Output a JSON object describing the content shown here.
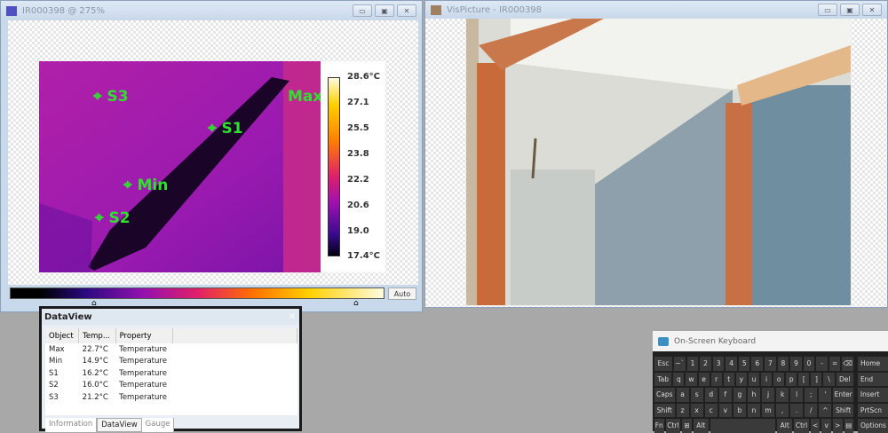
{
  "ir_window": {
    "title": "IR000398 @ 275%",
    "auto_label": "Auto",
    "scale": {
      "max": "28.6°C",
      "ticks": [
        "27.1",
        "25.5",
        "23.8",
        "22.2",
        "20.6",
        "19.0"
      ],
      "min": "17.4°C"
    },
    "markers": [
      "S3",
      "S1",
      "Max",
      "Min",
      "S2"
    ]
  },
  "vis_window": {
    "title": "VisPicture - IR000398"
  },
  "window_controls": {
    "minimize": "▭",
    "restore": "▣",
    "close": "✕"
  },
  "dataview": {
    "title": "DataView",
    "close": "×",
    "columns": [
      "Object",
      "Temp...",
      "Property"
    ],
    "rows": [
      [
        "Max",
        "22.7°C",
        "Temperature"
      ],
      [
        "Min",
        "14.9°C",
        "Temperature"
      ],
      [
        "S1",
        "16.2°C",
        "Temperature"
      ],
      [
        "S2",
        "16.0°C",
        "Temperature"
      ],
      [
        "S3",
        "21.2°C",
        "Temperature"
      ]
    ],
    "tabs": [
      "Information",
      "DataView",
      "Gauge"
    ],
    "active_tab": "DataView"
  },
  "keyboard": {
    "title": "On-Screen Keyboard",
    "rows": [
      [
        "Esc",
        "~`",
        "1",
        "2",
        "3",
        "4",
        "5",
        "6",
        "7",
        "8",
        "9",
        "0",
        "-",
        "=",
        "⌫"
      ],
      [
        "Tab",
        "q",
        "w",
        "e",
        "r",
        "t",
        "y",
        "u",
        "i",
        "o",
        "p",
        "[",
        "]",
        "\\",
        "Del"
      ],
      [
        "Caps",
        "a",
        "s",
        "d",
        "f",
        "g",
        "h",
        "j",
        "k",
        "l",
        ";",
        "'",
        "Enter"
      ],
      [
        "Shift",
        "z",
        "x",
        "c",
        "v",
        "b",
        "n",
        "m",
        ",",
        ".",
        "/",
        "^",
        "Shift"
      ],
      [
        "Fn",
        "Ctrl",
        "⊞",
        "Alt",
        " ",
        "Alt",
        "Ctrl",
        "<",
        "v",
        ">",
        "▤"
      ]
    ],
    "side": [
      "Home",
      "End",
      "Insert",
      "PrtScn",
      "Options"
    ]
  }
}
